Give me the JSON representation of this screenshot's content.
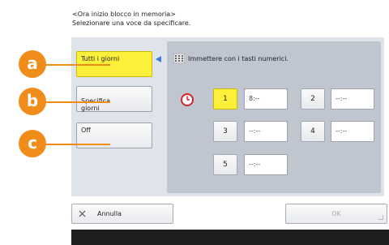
{
  "header": {
    "line1": "<Ora inizio blocco in memoria>",
    "line2": "Selezionare una voce da specificare."
  },
  "options": [
    {
      "label": "Tutti i giorni",
      "selected": true
    },
    {
      "label": "Specifica\ngiorni",
      "selected": false
    },
    {
      "label": "Off",
      "selected": false
    }
  ],
  "instruction": {
    "icon": "keypad-icon",
    "text": "Immettere con i tasti numerici."
  },
  "clock_icon": "clock-icon",
  "days": [
    {
      "number": "1",
      "time": "8:--",
      "active": true
    },
    {
      "number": "2",
      "time": "--:--",
      "active": false
    },
    {
      "number": "3",
      "time": "--:--",
      "active": false
    },
    {
      "number": "4",
      "time": "--:--",
      "active": false
    },
    {
      "number": "5",
      "time": "--:--",
      "active": false
    }
  ],
  "footer": {
    "cancel_icon": "close-icon",
    "cancel_label": "Annulla",
    "ok_label": "OK"
  },
  "callouts": [
    "a",
    "b",
    "c"
  ],
  "colors": {
    "accent_yellow": "#fdf03a",
    "callout_orange": "#f08d1a",
    "arrow_blue": "#3b7dd8",
    "panel": "#dfe3ea",
    "main_area": "#bfc6d0"
  }
}
